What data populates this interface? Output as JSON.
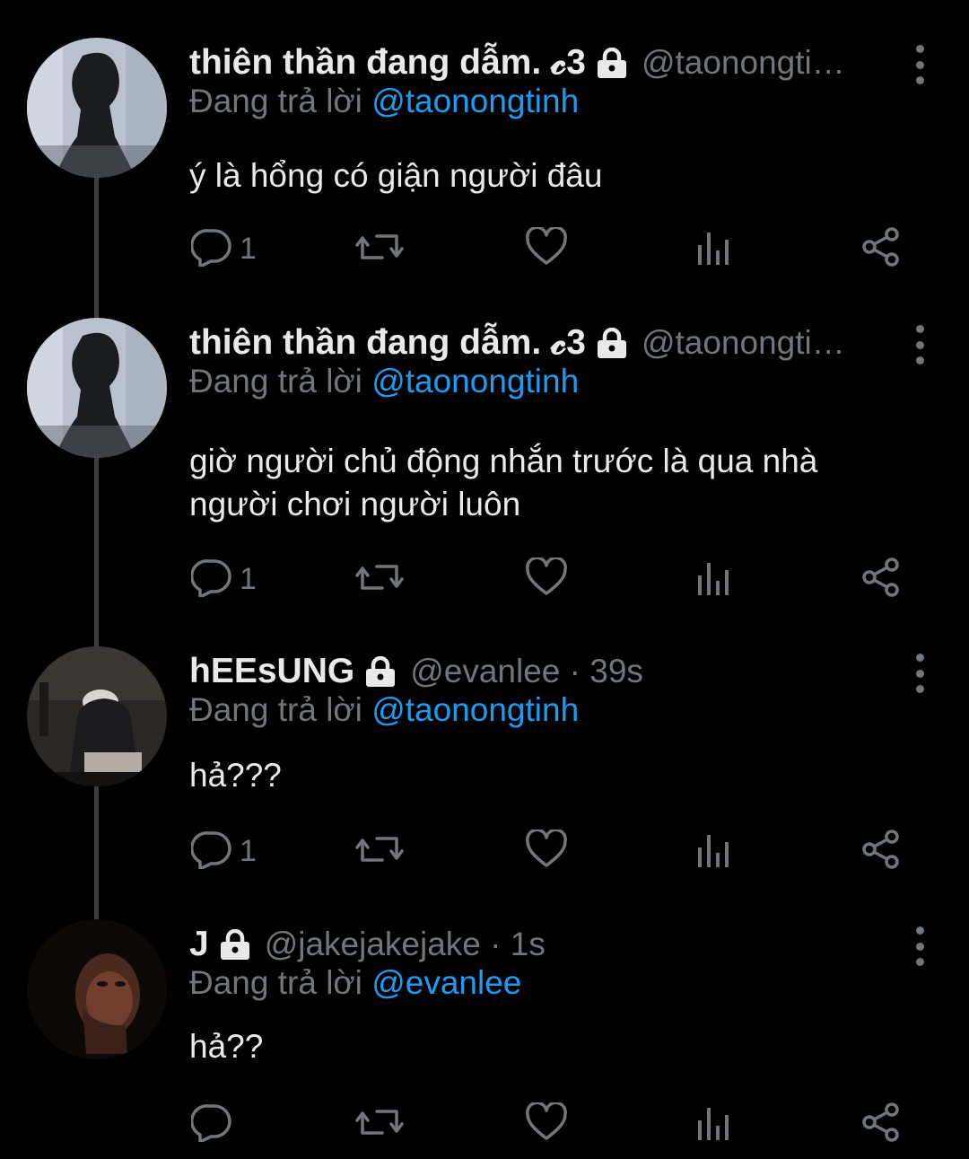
{
  "colors": {
    "background": "#000000",
    "text": "#e7e9ea",
    "muted": "#71767b",
    "accent": "#1d9bf0",
    "thread_line": "#3a3d40"
  },
  "icons": [
    "lock-icon",
    "more-icon",
    "reply-icon",
    "retweet-icon",
    "like-icon",
    "analytics-icon",
    "share-icon"
  ],
  "tweets": [
    {
      "name": "thiên thần đang dẫm. 𝓬3",
      "handle": "@taonongti…",
      "replying_prefix": "Đang trả lời",
      "replying_to": "@taonongtinh",
      "text": "ý là hổng có giận người đâu",
      "reply_count": "1"
    },
    {
      "name": "thiên thần đang dẫm. 𝓬3",
      "handle": "@taonongti…",
      "replying_prefix": "Đang trả lời",
      "replying_to": "@taonongtinh",
      "text": "giờ người chủ động nhắn trước là qua nhà người chơi người luôn",
      "reply_count": "1"
    },
    {
      "name": "hEEsUNG",
      "handle": "@evanlee · 39s",
      "replying_prefix": "Đang trả lời",
      "replying_to": "@taonongtinh",
      "text": "hả???",
      "reply_count": "1"
    },
    {
      "name": "J",
      "handle": "@jakejakejake · 1s",
      "replying_prefix": "Đang trả lời",
      "replying_to": "@evanlee",
      "text": "hả??",
      "reply_count": ""
    }
  ]
}
